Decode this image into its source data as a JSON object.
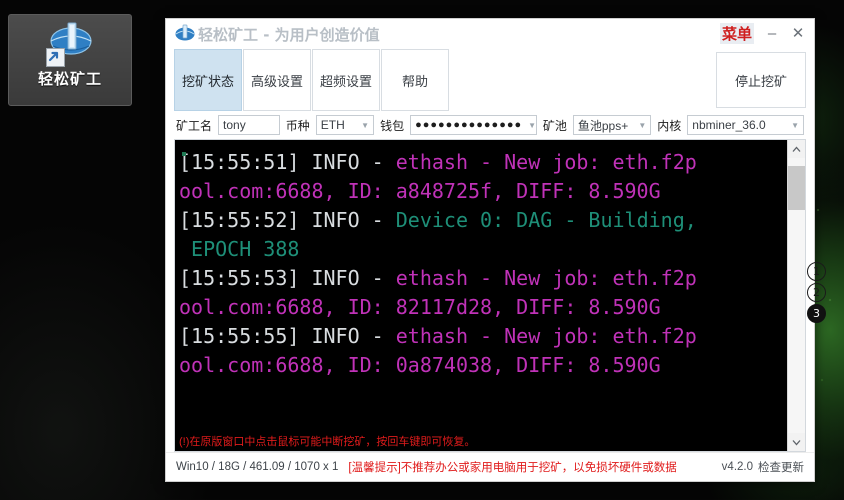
{
  "desktop": {
    "shortcut": {
      "label": "轻松矿工",
      "icon": "mining-globe-icon",
      "overlay_icon": "shortcut-arrow-icon"
    },
    "page_markers": [
      {
        "label": "①",
        "value": "1",
        "active": false
      },
      {
        "label": "②",
        "value": "2",
        "active": false
      },
      {
        "label": "③",
        "value": "3",
        "active": true
      }
    ]
  },
  "window": {
    "title": "轻松矿工 - 为用户创造价值",
    "title_icon": "app-globe-icon",
    "controls": {
      "menu_label": "菜单",
      "minimize_label": "–",
      "close_label": "✕"
    },
    "tabs": [
      {
        "label": "挖矿状态",
        "active": true
      },
      {
        "label": "高级设置",
        "active": false
      },
      {
        "label": "超频设置",
        "active": false
      },
      {
        "label": "帮助",
        "active": false
      }
    ],
    "stop_button_label": "停止挖矿",
    "form": {
      "miner_name_label": "矿工名",
      "miner_name_value": "tony",
      "coin_label": "币种",
      "coin_value": "ETH",
      "wallet_label": "钱包",
      "wallet_value": "●●●●●●●●●●●●●●",
      "pool_label": "矿池",
      "pool_value": "鱼池pps+",
      "kernel_label": "内核",
      "kernel_value": "nbminer_36.0"
    },
    "console": {
      "lines": [
        {
          "prefix": "[15:55:51] INFO - ",
          "body": "ethash - New job: eth.f2p",
          "color": "magenta"
        },
        {
          "prefix": "",
          "body": "ool.com:6688, ID: a848725f, DIFF: 8.590G",
          "color": "magenta"
        },
        {
          "prefix": "[15:55:52] INFO - ",
          "body": "Device 0: DAG - Building,",
          "color": "teal"
        },
        {
          "prefix": "",
          "body": " EPOCH 388",
          "color": "teal"
        },
        {
          "prefix": "[15:55:53] INFO - ",
          "body": "ethash - New job: eth.f2p",
          "color": "magenta"
        },
        {
          "prefix": "",
          "body": "ool.com:6688, ID: 82117d28, DIFF: 8.590G",
          "color": "magenta"
        },
        {
          "prefix": "[15:55:55] INFO - ",
          "body": "ethash - New job: eth.f2p",
          "color": "magenta"
        },
        {
          "prefix": "",
          "body": "ool.com:6688, ID: 0a874038, DIFF: 8.590G",
          "color": "magenta"
        }
      ],
      "warning": "(!)在原版窗口中点击鼠标可能中断挖矿，按回车键即可恢复。",
      "scrollbar": {
        "up_arrow": "⌃",
        "down_arrow": "⌄"
      }
    },
    "statusbar": {
      "system_info": "Win10  / 18G / 461.09 / 1070 x 1",
      "tip": "[温馨提示]不推荐办公或家用电脑用于挖矿，以免损坏硬件或数据",
      "version": "v4.2.0",
      "check_update": "检查更新"
    }
  },
  "colors": {
    "accent_blue": "#cfe2f0",
    "menu_red": "#cf1f1f",
    "warning_red": "#e01b1b",
    "log_magenta": "#c032b8",
    "log_teal": "#1e8f78",
    "log_white": "#d9dde0"
  }
}
